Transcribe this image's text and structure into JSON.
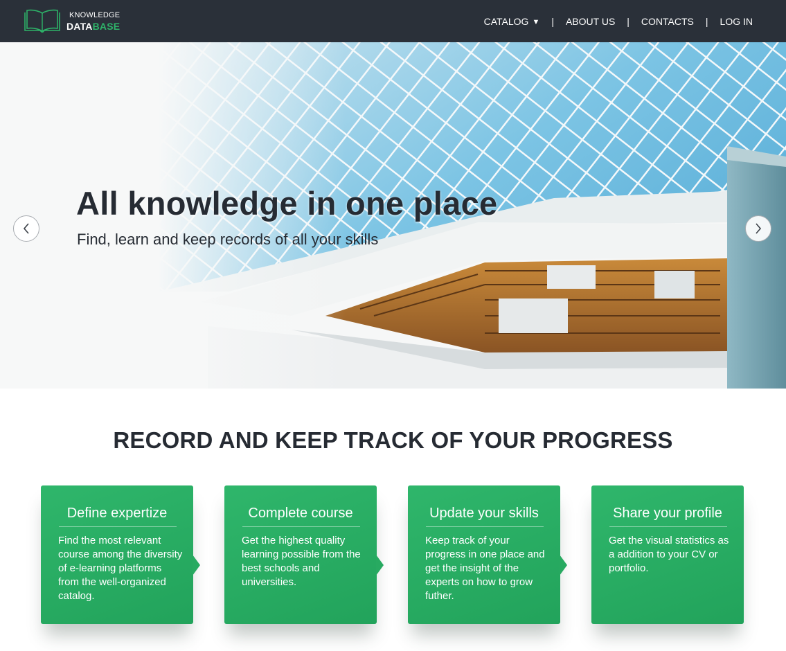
{
  "brand": {
    "line1": "KNOWLEDGE",
    "line2_a": "DATA",
    "line2_b": "BASE",
    "accent_color": "#2eb369",
    "header_color": "#2a3039"
  },
  "nav": {
    "catalog": "CATALOG",
    "about": "ABOUT US",
    "contacts": "CONTACTS",
    "login": "LOG IN",
    "separator": "|"
  },
  "hero": {
    "title": "All knowledge in one place",
    "subtitle": "Find, learn and keep records of all your skills",
    "prev_icon": "chevron-left-icon",
    "next_icon": "chevron-right-icon"
  },
  "progress": {
    "heading": "RECORD AND KEEP TRACK OF YOUR PROGRESS",
    "cards": [
      {
        "title": "Define expertize",
        "text": "Find the most relevant course among the diversity of e-learning platforms from the well-organized catalog."
      },
      {
        "title": "Complete course",
        "text": "Get the highest quality learning possible from the best schools and universities."
      },
      {
        "title": "Update your skills",
        "text": "Keep track of your progress in one place and get the insight of the experts on how to grow futher."
      },
      {
        "title": "Share your profile",
        "text": "Get the visual statistics as a addition to your CV or portfolio."
      }
    ]
  }
}
